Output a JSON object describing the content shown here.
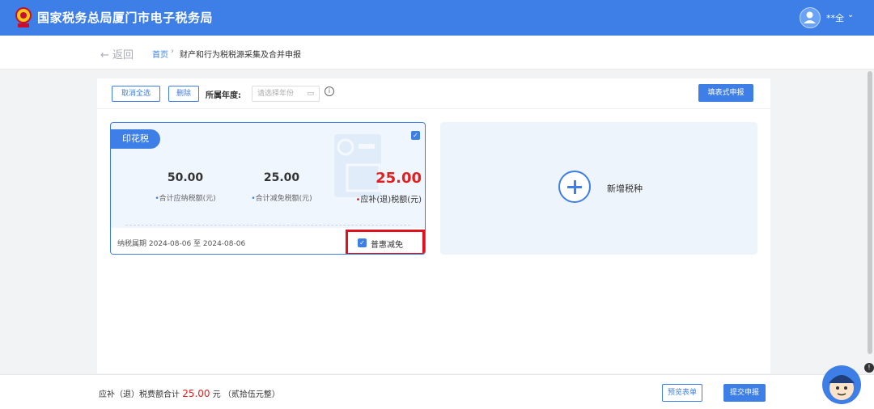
{
  "header": {
    "site_title": "国家税务总局厦门市电子税务局",
    "user_name": "**全",
    "caret": "⌄"
  },
  "breadcrumb": {
    "back_label": "← 返回",
    "home_label": "首页",
    "separator": "›",
    "current_label": "财产和行为税税源采集及合并申报"
  },
  "toolbar": {
    "cancel_all_label": "取消全选",
    "delete_label": "删除",
    "year_label": "所属年度:",
    "year_placeholder": "请选择年份",
    "fill_report_label": "填表式申报"
  },
  "tax_card": {
    "tax_name": "印花税",
    "total_payable_value": "50.00",
    "total_payable_label": "合计应纳税额(元)",
    "total_relief_value": "25.00",
    "total_relief_label": "合计减免税额(元)",
    "refund_value": "25.00",
    "refund_label": "应补(退)税额(元)",
    "period_label": "纳税属期 2024-08-06 至 2024-08-06",
    "relief_option_label": "普惠减免",
    "relief_checked": true,
    "card_checked": true
  },
  "add_card": {
    "label": "新增税种"
  },
  "footer": {
    "total_prefix": "应补（退）税费额合计",
    "total_amount": "25.00",
    "total_suffix": "元 （贰拾伍元整）",
    "preview_label": "预览表单",
    "submit_label": "提交申报"
  },
  "colors": {
    "brand": "#3d7fe6",
    "highlight_red": "#e0101f",
    "amount_red": "#e02020"
  }
}
